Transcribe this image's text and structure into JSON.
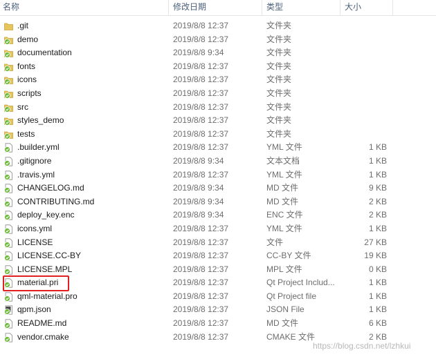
{
  "columns": {
    "name": "名称",
    "date": "修改日期",
    "type": "类型",
    "size": "大小"
  },
  "rows": [
    {
      "name": ".git",
      "date": "2019/8/8 12:37",
      "type": "文件夹",
      "size": "",
      "icon": "folder-icon"
    },
    {
      "name": "demo",
      "date": "2019/8/8 12:37",
      "type": "文件夹",
      "size": "",
      "icon": "folder-green-icon"
    },
    {
      "name": "documentation",
      "date": "2019/8/8 9:34",
      "type": "文件夹",
      "size": "",
      "icon": "folder-green-icon"
    },
    {
      "name": "fonts",
      "date": "2019/8/8 12:37",
      "type": "文件夹",
      "size": "",
      "icon": "folder-green-icon"
    },
    {
      "name": "icons",
      "date": "2019/8/8 12:37",
      "type": "文件夹",
      "size": "",
      "icon": "folder-green-icon"
    },
    {
      "name": "scripts",
      "date": "2019/8/8 12:37",
      "type": "文件夹",
      "size": "",
      "icon": "folder-green-icon"
    },
    {
      "name": "src",
      "date": "2019/8/8 12:37",
      "type": "文件夹",
      "size": "",
      "icon": "folder-green-icon"
    },
    {
      "name": "styles_demo",
      "date": "2019/8/8 12:37",
      "type": "文件夹",
      "size": "",
      "icon": "folder-green-icon"
    },
    {
      "name": "tests",
      "date": "2019/8/8 12:37",
      "type": "文件夹",
      "size": "",
      "icon": "folder-green-icon"
    },
    {
      "name": ".builder.yml",
      "date": "2019/8/8 12:37",
      "type": "YML 文件",
      "size": "1 KB",
      "icon": "file-green-icon"
    },
    {
      "name": ".gitignore",
      "date": "2019/8/8 9:34",
      "type": "文本文档",
      "size": "1 KB",
      "icon": "file-green-icon"
    },
    {
      "name": ".travis.yml",
      "date": "2019/8/8 12:37",
      "type": "YML 文件",
      "size": "1 KB",
      "icon": "file-green-icon"
    },
    {
      "name": "CHANGELOG.md",
      "date": "2019/8/8 9:34",
      "type": "MD 文件",
      "size": "9 KB",
      "icon": "file-green-icon"
    },
    {
      "name": "CONTRIBUTING.md",
      "date": "2019/8/8 9:34",
      "type": "MD 文件",
      "size": "2 KB",
      "icon": "file-green-icon"
    },
    {
      "name": "deploy_key.enc",
      "date": "2019/8/8 9:34",
      "type": "ENC 文件",
      "size": "2 KB",
      "icon": "file-green-icon"
    },
    {
      "name": "icons.yml",
      "date": "2019/8/8 12:37",
      "type": "YML 文件",
      "size": "1 KB",
      "icon": "file-green-icon"
    },
    {
      "name": "LICENSE",
      "date": "2019/8/8 12:37",
      "type": "文件",
      "size": "27 KB",
      "icon": "file-green-icon"
    },
    {
      "name": "LICENSE.CC-BY",
      "date": "2019/8/8 12:37",
      "type": "CC-BY 文件",
      "size": "19 KB",
      "icon": "file-green-icon"
    },
    {
      "name": "LICENSE.MPL",
      "date": "2019/8/8 12:37",
      "type": "MPL 文件",
      "size": "0 KB",
      "icon": "file-green-icon"
    },
    {
      "name": "material.pri",
      "date": "2019/8/8 12:37",
      "type": "Qt Project Includ...",
      "size": "1 KB",
      "icon": "file-green-icon"
    },
    {
      "name": "qml-material.pro",
      "date": "2019/8/8 12:37",
      "type": "Qt Project file",
      "size": "1 KB",
      "icon": "file-green-icon"
    },
    {
      "name": "qpm.json",
      "date": "2019/8/8 12:37",
      "type": "JSON File",
      "size": "1 KB",
      "icon": "json-file-icon"
    },
    {
      "name": "README.md",
      "date": "2019/8/8 12:37",
      "type": "MD 文件",
      "size": "6 KB",
      "icon": "file-green-icon"
    },
    {
      "name": "vendor.cmake",
      "date": "2019/8/8 12:37",
      "type": "CMAKE 文件",
      "size": "2 KB",
      "icon": "file-green-icon"
    }
  ],
  "watermark": "https://blog.csdn.net/lzhkui",
  "colors": {
    "highlight": "#e02020",
    "folder": "#e8c45c",
    "badge": "#6dbb3a"
  }
}
